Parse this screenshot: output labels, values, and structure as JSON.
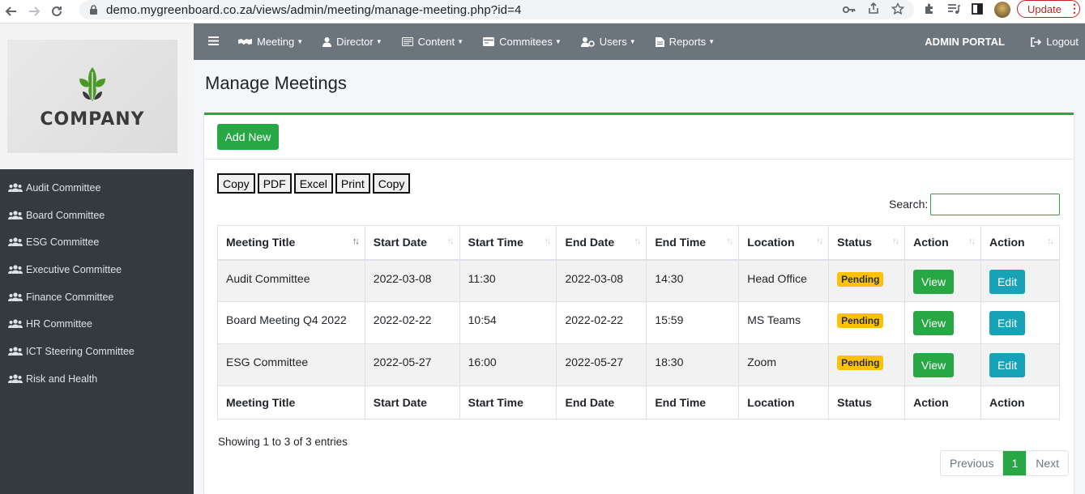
{
  "browser": {
    "url": "demo.mygreenboard.co.za/views/admin/meeting/manage-meeting.php?id=4",
    "update_label": "Update"
  },
  "brand": {
    "logo_text": "COMPANY"
  },
  "sidebar": {
    "items": [
      {
        "label": "Audit Committee"
      },
      {
        "label": "Board Committee"
      },
      {
        "label": "ESG Committee"
      },
      {
        "label": "Executive Committee"
      },
      {
        "label": "Finance Committee"
      },
      {
        "label": "HR Committee"
      },
      {
        "label": "ICT Steering Committee"
      },
      {
        "label": "Risk and Health"
      }
    ]
  },
  "topnav": {
    "menus": [
      {
        "label": "Meeting",
        "icon": "meeting-icon"
      },
      {
        "label": "Director",
        "icon": "user-icon"
      },
      {
        "label": "Content",
        "icon": "content-icon"
      },
      {
        "label": "Commitees",
        "icon": "card-icon"
      },
      {
        "label": "Users",
        "icon": "users-cog-icon"
      },
      {
        "label": "Reports",
        "icon": "report-icon"
      }
    ],
    "portal_label": "ADMIN PORTAL",
    "logout_label": "Logout"
  },
  "page": {
    "title": "Manage Meetings",
    "add_new_label": "Add New",
    "export_buttons": [
      "Copy",
      "PDF",
      "Excel",
      "Print",
      "Copy"
    ],
    "search_label": "Search:",
    "search_value": ""
  },
  "table": {
    "columns": [
      "Meeting Title",
      "Start Date",
      "Start Time",
      "End Date",
      "End Time",
      "Location",
      "Status",
      "Action",
      "Action"
    ],
    "rows": [
      {
        "title": "Audit Committee",
        "start_date": "2022-03-08",
        "start_time": "11:30",
        "end_date": "2022-03-08",
        "end_time": "14:30",
        "location": "Head Office",
        "status": "Pending",
        "view": "View",
        "edit": "Edit"
      },
      {
        "title": "Board Meeting Q4 2022",
        "start_date": "2022-02-22",
        "start_time": "10:54",
        "end_date": "2022-02-22",
        "end_time": "15:59",
        "location": "MS Teams",
        "status": "Pending",
        "view": "View",
        "edit": "Edit"
      },
      {
        "title": "ESG Committee",
        "start_date": "2022-05-27",
        "start_time": "16:00",
        "end_date": "2022-05-27",
        "end_time": "18:30",
        "location": "Zoom",
        "status": "Pending",
        "view": "View",
        "edit": "Edit"
      }
    ],
    "info": "Showing 1 to 3 of 3 entries",
    "pagination": {
      "previous": "Previous",
      "current": "1",
      "next": "Next"
    }
  },
  "colors": {
    "accent_green": "#28a745",
    "info_teal": "#17a2b8",
    "badge_yellow": "#ffc107",
    "sidebar_bg": "#343a40",
    "navbar_bg": "#6c757d"
  }
}
